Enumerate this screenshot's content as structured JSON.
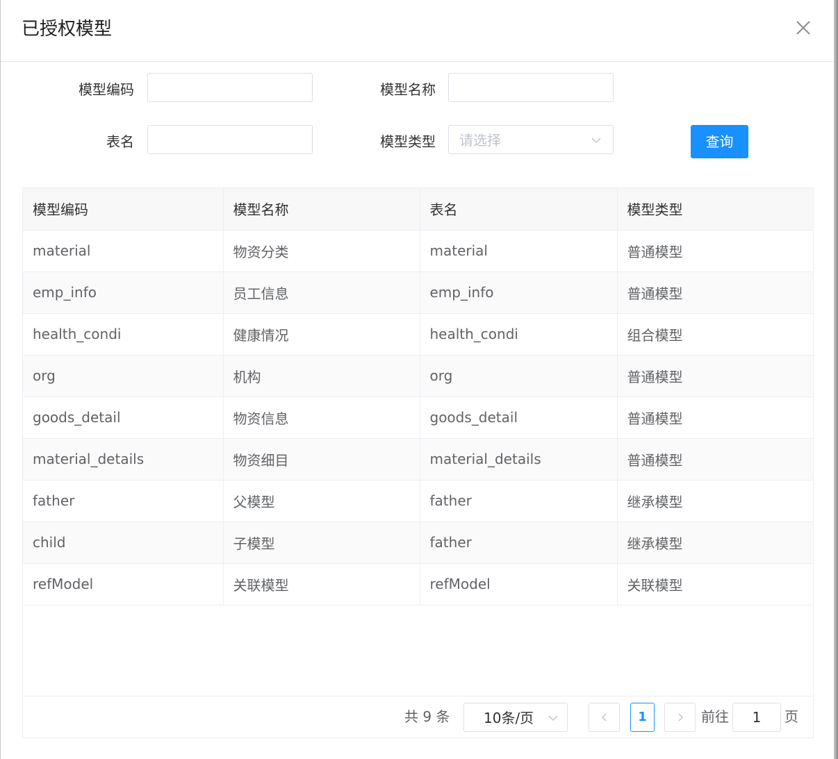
{
  "dialog": {
    "title": "已授权模型",
    "close_icon": "close-icon"
  },
  "form": {
    "model_code_label": "模型编码",
    "model_code_value": "",
    "model_name_label": "模型名称",
    "model_name_value": "",
    "table_name_label": "表名",
    "table_name_value": "",
    "model_type_label": "模型类型",
    "model_type_placeholder": "请选择",
    "query_button": "查询"
  },
  "table": {
    "columns": [
      "模型编码",
      "模型名称",
      "表名",
      "模型类型"
    ],
    "rows": [
      [
        "material",
        "物资分类",
        "material",
        "普通模型"
      ],
      [
        "emp_info",
        "员工信息",
        "emp_info",
        "普通模型"
      ],
      [
        "health_condi",
        "健康情况",
        "health_condi",
        "组合模型"
      ],
      [
        "org",
        "机构",
        "org",
        "普通模型"
      ],
      [
        "goods_detail",
        "物资信息",
        "goods_detail",
        "普通模型"
      ],
      [
        "material_details",
        "物资细目",
        "material_details",
        "普通模型"
      ],
      [
        "father",
        "父模型",
        "father",
        "继承模型"
      ],
      [
        "child",
        "子模型",
        "father",
        "继承模型"
      ],
      [
        "refModel",
        "关联模型",
        "refModel",
        "关联模型"
      ]
    ]
  },
  "pagination": {
    "total_text": "共 9 条",
    "page_size": "10条/页",
    "current_page": "1",
    "goto_label": "前往",
    "goto_value": "1",
    "page_unit": "页"
  },
  "colors": {
    "primary": "#1890ff",
    "header_bg": "#f8f8f9",
    "stripe_bg": "#fafafa",
    "border": "#ebeef5"
  }
}
